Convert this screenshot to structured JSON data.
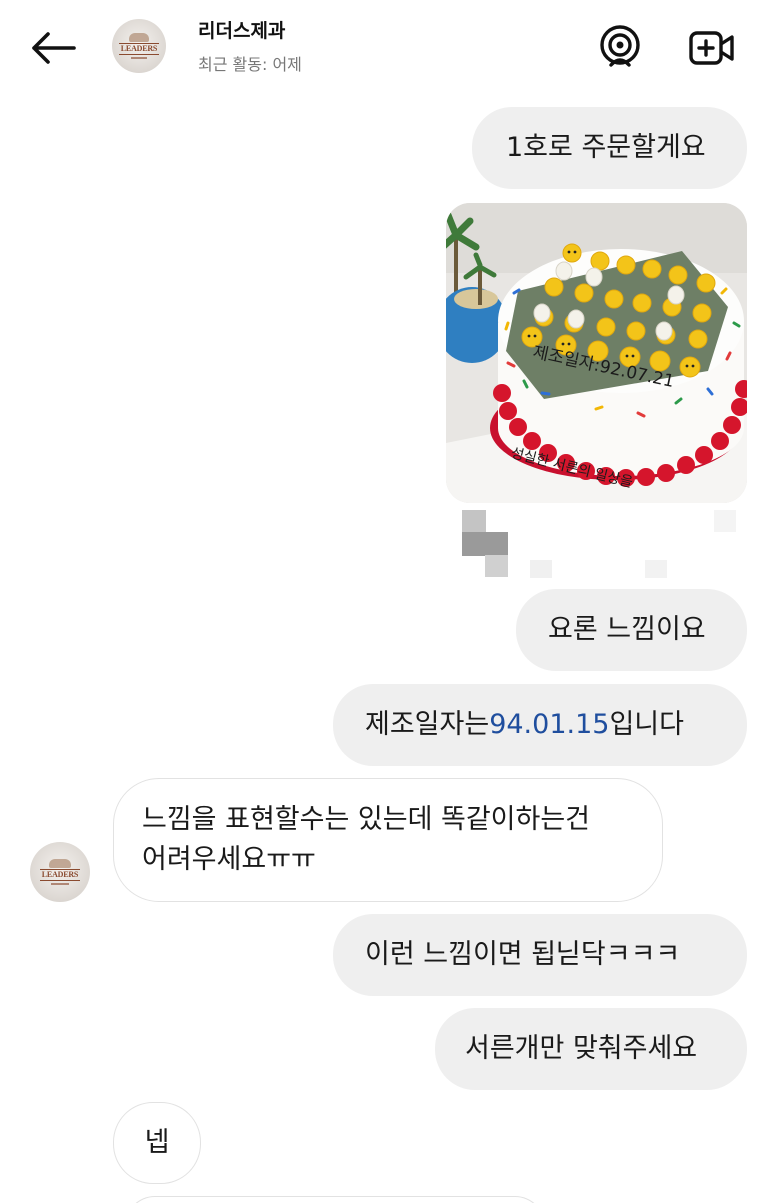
{
  "header": {
    "name": "리더스제과",
    "status": "최근 활동: 어제",
    "avatar_brand": "LEADERS"
  },
  "messages": {
    "m1": "1호로 주문할게요",
    "m2": "요론 느낌이요",
    "m3_pre": "제조일자는 ",
    "m3_hl": "94.01.15",
    "m3_post": " 입니다",
    "m4_line1": "느낌을 표현할수는 있는데 똑같이하는건",
    "m4_line2": "어려우세요ㅠㅠ",
    "m5": "이런 느낌이면 됩닏닥ㅋㅋㅋ",
    "m6": "서른개만 맞춰주세요",
    "m7": "넵"
  },
  "photo": {
    "cake_text": "제조일자:92.07.21",
    "cake_text_bottom": "성실한 서른의 일상을"
  },
  "colors": {
    "bubble_out": "#efefef",
    "link_number": "#1f4e9e",
    "status_gray": "#777777"
  },
  "icons": [
    "back-arrow-icon",
    "audio-call-icon",
    "video-call-icon"
  ]
}
